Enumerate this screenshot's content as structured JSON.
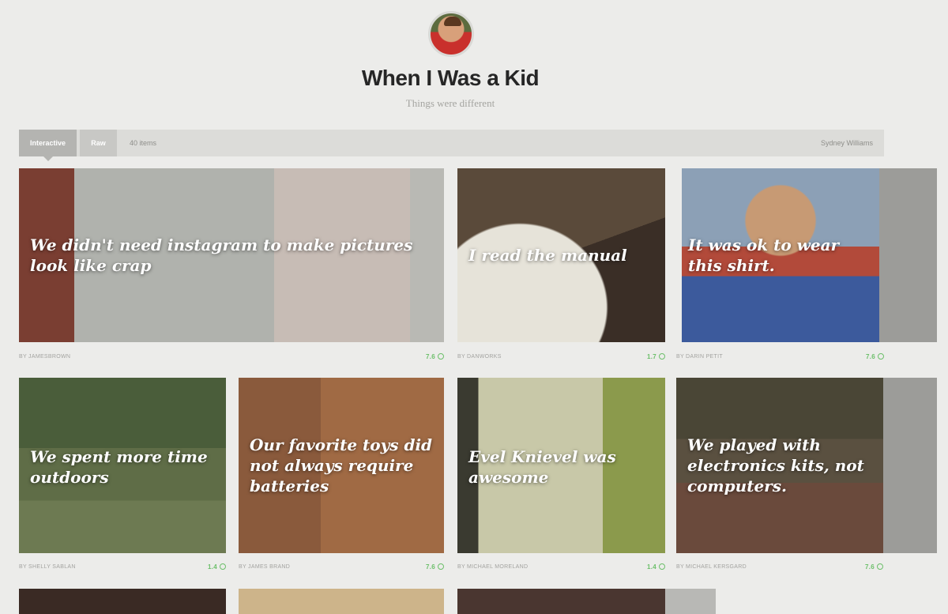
{
  "board": {
    "title": "When I Was a Kid",
    "subtitle": "Things were different"
  },
  "toolbar": {
    "tabs": [
      {
        "label": "Interactive",
        "active": true
      },
      {
        "label": "Raw",
        "active": false
      }
    ],
    "item_count": "40 items",
    "owner": "Sydney Williams"
  },
  "cards": [
    {
      "caption": "We didn't need instagram to make pictures look like crap",
      "author": "BY JAMESBROWN",
      "likes": "7.6"
    },
    {
      "caption": "I read the manual",
      "author": "BY DANWORKS",
      "likes": "1.7"
    },
    {
      "caption": "It was ok to wear this shirt.",
      "author": "BY DARIN PETIT",
      "likes": "7.6"
    },
    {
      "caption": "We spent more time outdoors",
      "author": "BY SHELLY SABLAN",
      "likes": "1.4"
    },
    {
      "caption": "Our favorite toys did not always require batteries",
      "author": "BY JAMES BRAND",
      "likes": "7.6"
    },
    {
      "caption": "Evel Knievel was awesome",
      "author": "BY MICHAEL MORELAND",
      "likes": "1.4"
    },
    {
      "caption": "We played with electronics kits, not computers.",
      "author": "BY MICHAEL KERSGARD",
      "likes": "7.6"
    }
  ],
  "colors": {
    "background": "#ececea",
    "like_green": "#6cbf6a",
    "toolbar": "#dcdcd9"
  },
  "icons": {
    "like": "circle-like-icon"
  }
}
